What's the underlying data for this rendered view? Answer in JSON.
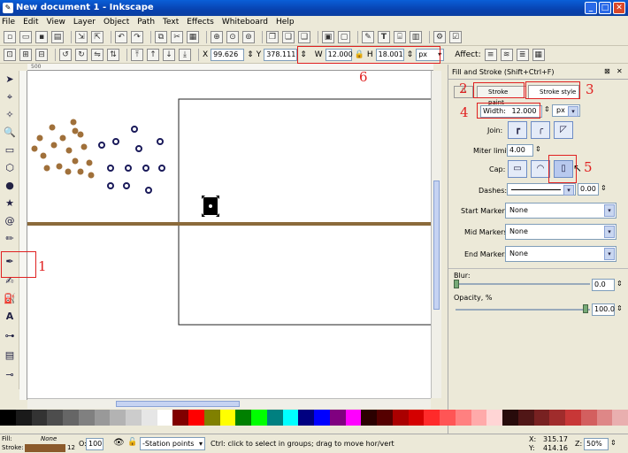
{
  "window": {
    "title": "New document 1 - Inkscape"
  },
  "menu": [
    "File",
    "Edit",
    "View",
    "Layer",
    "Object",
    "Path",
    "Text",
    "Effects",
    "Whiteboard",
    "Help"
  ],
  "toolcontrols": {
    "x_label": "X",
    "x": "99.626",
    "y_label": "Y",
    "y": "378.111",
    "w_label": "W",
    "w": "12.000",
    "h_label": "H",
    "h": "18.001",
    "unit": "px",
    "affect_label": "Affect:"
  },
  "panel": {
    "title": "Fill and Stroke (Shift+Ctrl+F)",
    "tabs": [
      "Stroke paint",
      "Stroke style"
    ],
    "width_label": "Width:",
    "width": "12.000",
    "width_unit": "px",
    "join_label": "Join:",
    "miter_label": "Miter limit:",
    "miter": "4.00",
    "cap_label": "Cap:",
    "dashes_label": "Dashes:",
    "dashes_offset": "0.00",
    "start_markers_label": "Start Markers:",
    "start_markers": "None",
    "mid_markers_label": "Mid Markers:",
    "mid_markers": "None",
    "end_markers_label": "End Markers:",
    "end_markers": "None",
    "blur_label": "Blur:",
    "blur": "0.0",
    "opacity_label": "Opacity, %",
    "opacity": "100.0"
  },
  "annotations": [
    "1",
    "2",
    "3",
    "4",
    "5",
    "6"
  ],
  "status": {
    "fill_label": "Fill:",
    "fill_value": "None",
    "stroke_label": "Stroke:",
    "stroke_width": "12",
    "o_label": "O:",
    "opacity": "100",
    "layer": "-Station points",
    "message": "Ctrl: click to select in groups; drag to move hor/vert",
    "x_label": "X:",
    "x": "315.17",
    "y_label": "Y:",
    "y": "414.16",
    "z_label": "Z:",
    "zoom": "50%"
  },
  "colors": {
    "title_bar": "#0842b0",
    "brown_dots": "#a0703a",
    "navy_circles": "#1a1a5a",
    "stroke_line": "#8b6a3a",
    "annotation": "#e02020"
  },
  "ruler": {
    "top_label": "500"
  }
}
